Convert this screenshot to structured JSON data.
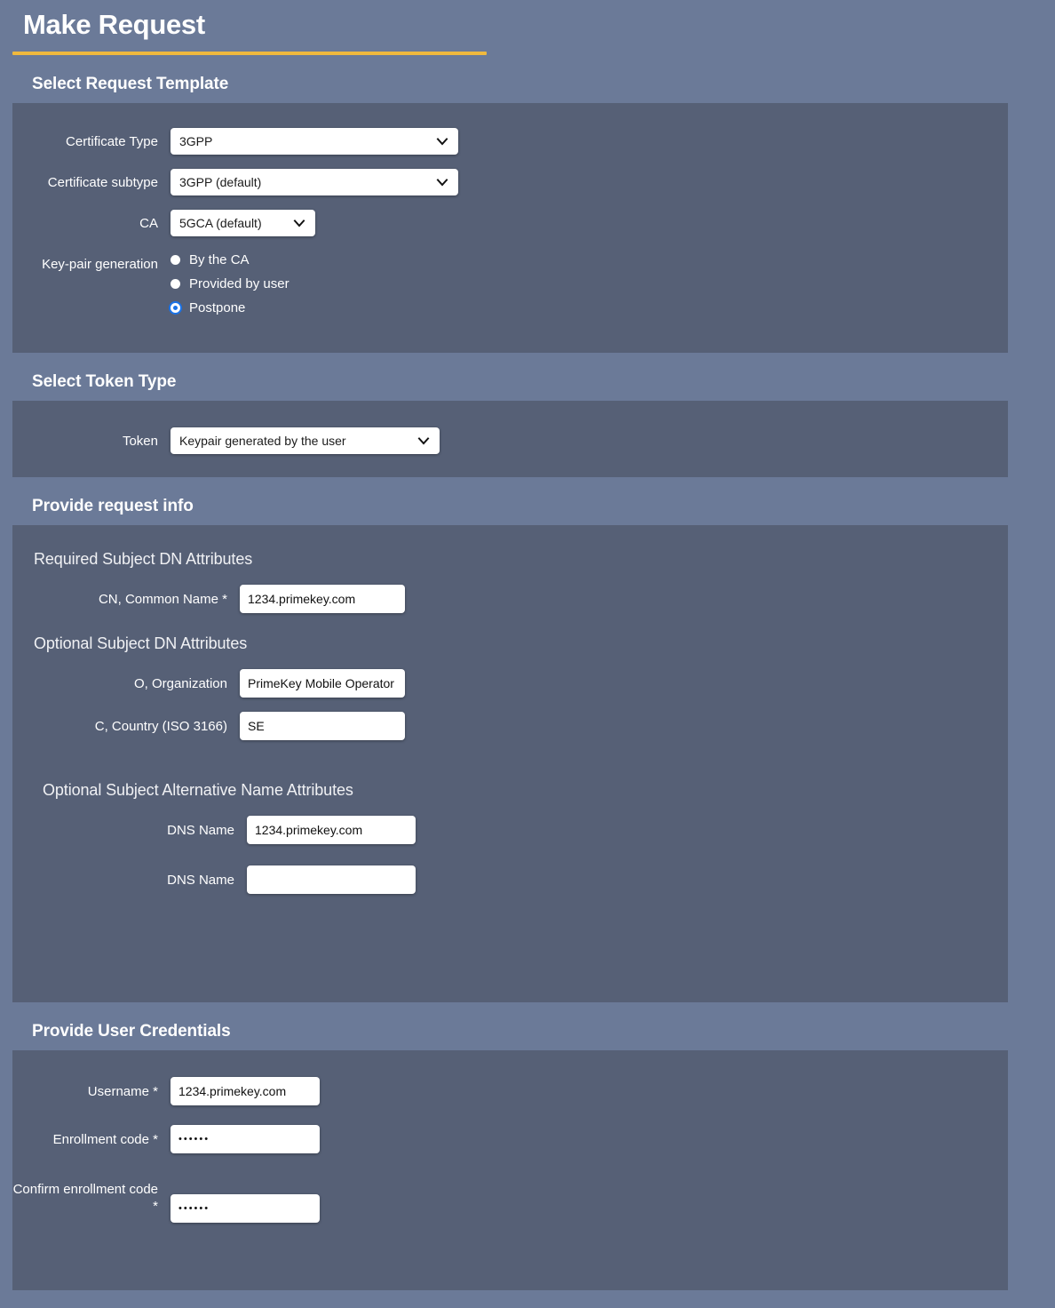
{
  "page": {
    "title": "Make Request",
    "accent_color": "#f0b93e",
    "background_color": "#6b7a98",
    "panel_color": "#566076"
  },
  "sections": {
    "template": {
      "heading": "Select Request Template",
      "fields": {
        "certificate_type": {
          "label": "Certificate Type",
          "value": "3GPP",
          "icon": "chevron-down-icon"
        },
        "certificate_subtype": {
          "label": "Certificate subtype",
          "value": "3GPP (default)",
          "icon": "chevron-down-icon"
        },
        "ca": {
          "label": "CA",
          "value": "5GCA (default)",
          "icon": "chevron-down-icon"
        },
        "key_pair_generation": {
          "label": "Key-pair generation",
          "options": [
            {
              "label": "By the CA",
              "selected": false
            },
            {
              "label": "Provided by user",
              "selected": false
            },
            {
              "label": "Postpone",
              "selected": true
            }
          ]
        }
      }
    },
    "token": {
      "heading": "Select Token Type",
      "fields": {
        "token": {
          "label": "Token",
          "value": "Keypair generated by the user",
          "icon": "chevron-down-icon"
        }
      }
    },
    "request_info": {
      "heading": "Provide request info",
      "required_dn": {
        "sub_heading": "Required Subject DN Attributes",
        "fields": [
          {
            "label": "CN, Common Name *",
            "value": "1234.primekey.com",
            "placeholder": ""
          }
        ]
      },
      "optional_dn": {
        "sub_heading": "Optional Subject DN Attributes",
        "fields": [
          {
            "label": "O, Organization",
            "value": "PrimeKey Mobile Operator AB",
            "placeholder": ""
          },
          {
            "label": "C, Country (ISO 3166)",
            "value": "SE",
            "placeholder": ""
          }
        ]
      },
      "optional_san": {
        "sub_heading": "Optional Subject Alternative Name Attributes",
        "fields": [
          {
            "label": "DNS Name",
            "value": "1234.primekey.com",
            "placeholder": ""
          },
          {
            "label": "DNS Name",
            "value": "",
            "placeholder": ""
          }
        ]
      }
    },
    "credentials": {
      "heading": "Provide User Credentials",
      "fields": {
        "username": {
          "label": "Username *",
          "value": "1234.primekey.com"
        },
        "enrollment_code": {
          "label": "Enrollment code *",
          "value": "••••••"
        },
        "confirm_enrollment_code": {
          "label": "Confirm enrollment code *",
          "value": "••••••"
        }
      }
    }
  }
}
